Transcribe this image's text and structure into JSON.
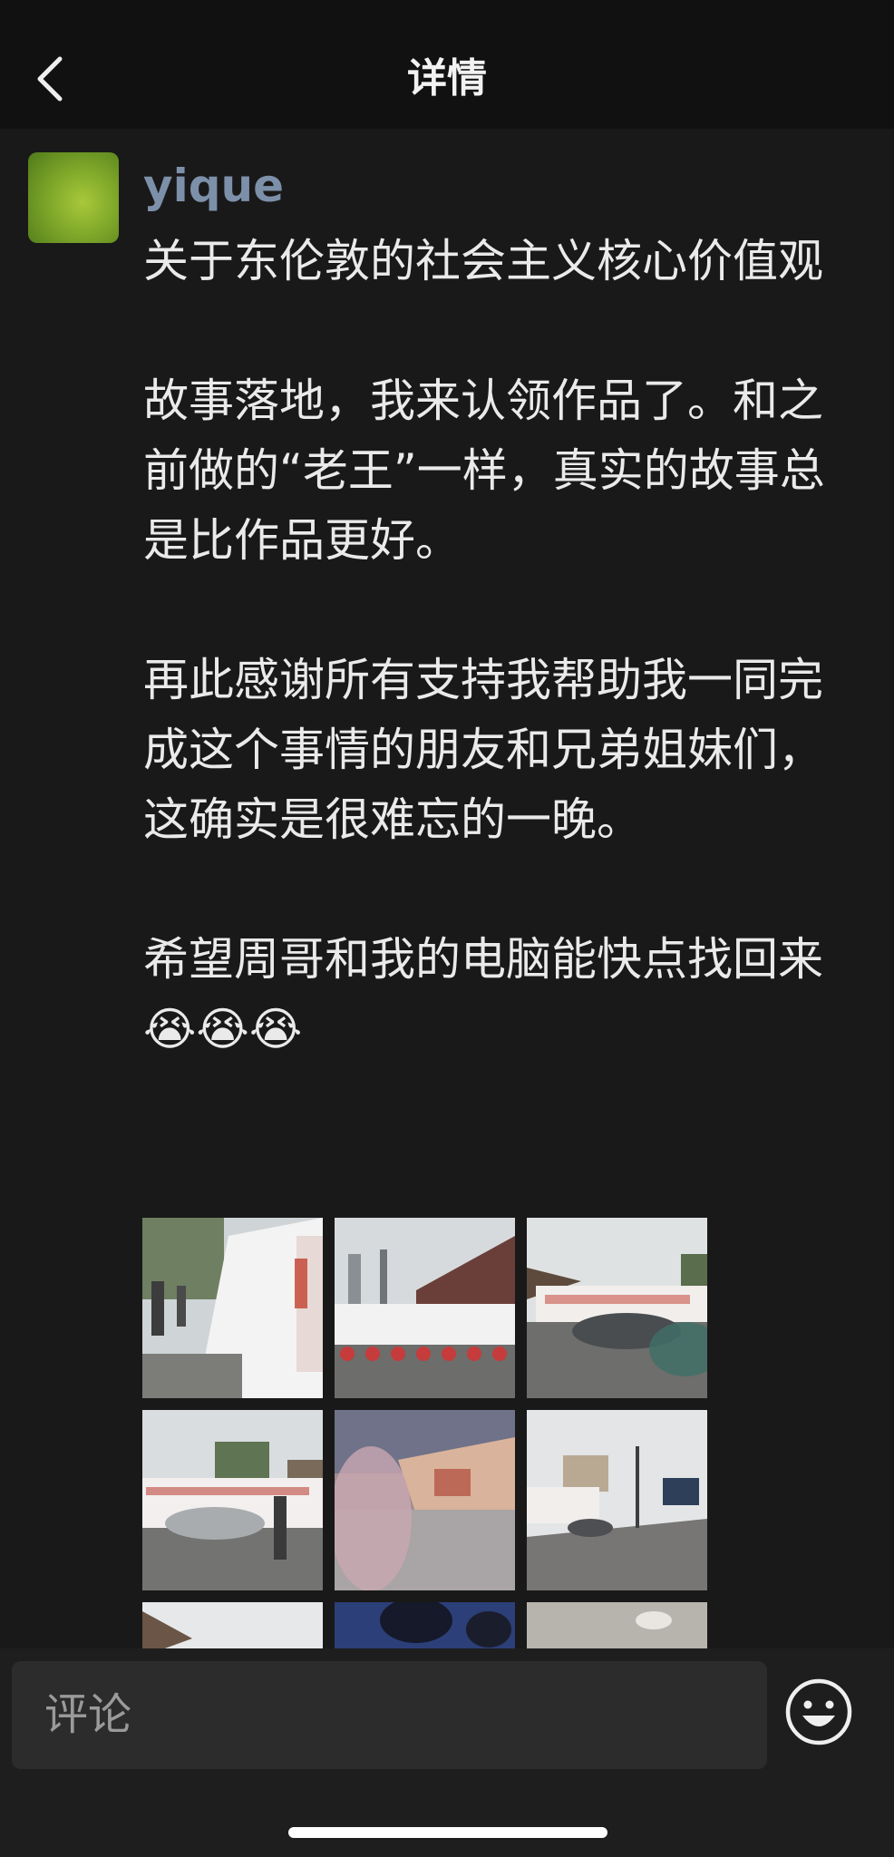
{
  "nav": {
    "title": "详情"
  },
  "post": {
    "author": "yique",
    "text": "关于东伦敦的社会主义核心价值观\n\n故事落地，我来认领作品了。和之前做的“老王”一样，真实的故事总是比作品更好。\n\n再此感谢所有支持我帮助我一同完成这个事情的朋友和兄弟姐妹们，这确实是很难忘的一晚。\n\n希望周哥和我的电脑能快点找回来😭😭😭"
  },
  "comment": {
    "placeholder": "评论"
  },
  "colors": {
    "background": "#191919",
    "nav_background": "#111111",
    "author_name": "#7d90a9",
    "text": "#eaeaea",
    "input_background": "#2c2c2c"
  },
  "icons": [
    "back-arrow-icon",
    "emoji-smiley-icon"
  ]
}
